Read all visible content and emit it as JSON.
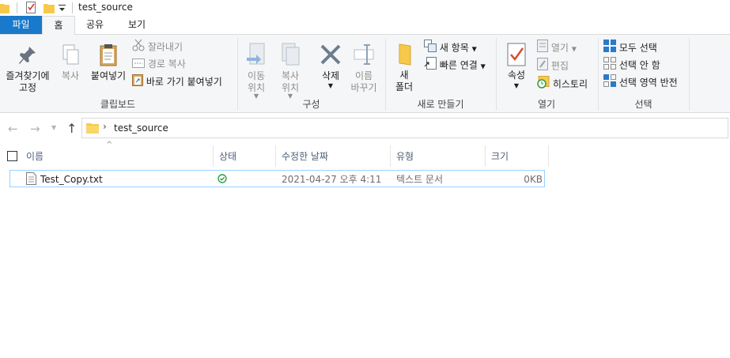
{
  "window": {
    "title": "test_source"
  },
  "tabs": [
    "파일",
    "홈",
    "공유",
    "보기"
  ],
  "ribbon": {
    "clipboard": {
      "pin": "즐겨찾기에\n고정",
      "copy": "복사",
      "paste": "붙여넣기",
      "cut": "잘라내기",
      "copy_path": "경로 복사",
      "paste_shortcut": "바로 가기 붙여넣기",
      "label": "클립보드"
    },
    "organize": {
      "move_to": "이동\n위치",
      "copy_to": "복사\n위치",
      "delete": "삭제",
      "rename": "이름\n바꾸기",
      "label": "구성"
    },
    "new": {
      "new_folder": "새\n폴더",
      "new_item": "새 항목",
      "easy_access": "빠른 연결",
      "label": "새로 만들기"
    },
    "open": {
      "properties": "속성",
      "open": "열기",
      "edit": "편집",
      "history": "히스토리",
      "label": "열기"
    },
    "select": {
      "select_all": "모두 선택",
      "select_none": "선택 안 함",
      "invert": "선택 영역 반전",
      "label": "선택"
    }
  },
  "address": {
    "path": "test_source"
  },
  "columns": [
    "이름",
    "상태",
    "수정한 날짜",
    "유형",
    "크기"
  ],
  "files": [
    {
      "name": "Test_Copy.txt",
      "status": "synced",
      "modified": "2021-04-27 오후 4:11",
      "type": "텍스트 문서",
      "size": "0KB"
    }
  ],
  "colors": {
    "accent": "#1979ca",
    "folder": "#f7c94b",
    "selection_border": "#99d1ff",
    "status_ok": "#2e9e47"
  }
}
